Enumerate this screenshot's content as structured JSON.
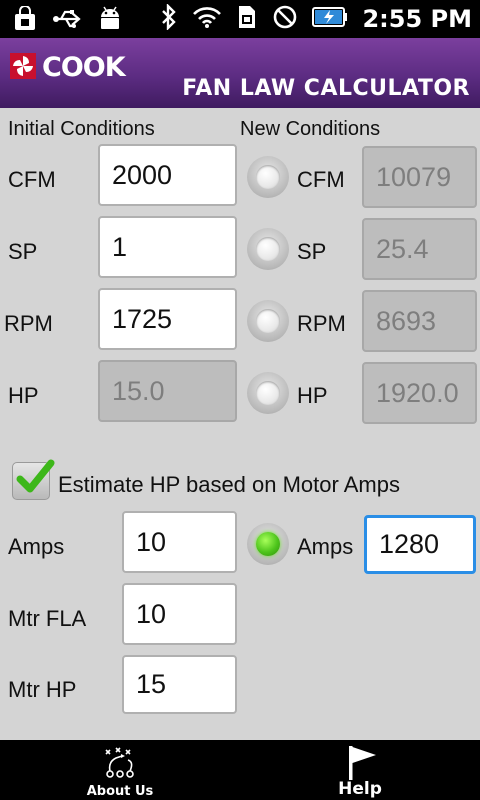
{
  "status_bar": {
    "time": "2:55 PM",
    "icons": [
      "bag-icon",
      "usb-icon",
      "android-icon",
      "bluetooth-icon",
      "wifi-icon",
      "sim-icon",
      "no-sound-icon",
      "battery-charging-icon"
    ]
  },
  "header": {
    "logo_text": "COOK",
    "title": "FAN LAW CALCULATOR"
  },
  "initial": {
    "heading": "Initial Conditions",
    "cfm_label": "CFM",
    "cfm_value": "2000",
    "sp_label": "SP",
    "sp_value": "1",
    "rpm_label": "RPM",
    "rpm_value": "1725",
    "hp_label": "HP",
    "hp_value": "15.0"
  },
  "new_conditions": {
    "heading": "New Conditions",
    "cfm_label": "CFM",
    "cfm_value": "10079",
    "sp_label": "SP",
    "sp_value": "25.4",
    "rpm_label": "RPM",
    "rpm_value": "8693",
    "hp_label": "HP",
    "hp_value": "1920.0"
  },
  "estimate": {
    "checkbox_label": "Estimate HP based on Motor Amps",
    "checked": true,
    "amps_label": "Amps",
    "amps_value": "10",
    "mtr_fla_label": "Mtr FLA",
    "mtr_fla_value": "10",
    "mtr_hp_label": "Mtr HP",
    "mtr_hp_value": "15",
    "new_amps_label": "Amps",
    "new_amps_value": "1280",
    "selected_radio": "amps"
  },
  "bottom_bar": {
    "about_label": "About Us",
    "help_label": "Help"
  },
  "colors": {
    "header_purple": "#5c2c82",
    "focus_blue": "#2a8ee6",
    "radio_selected_green": "#4ec51c",
    "checkmark_green": "#3db71a"
  }
}
